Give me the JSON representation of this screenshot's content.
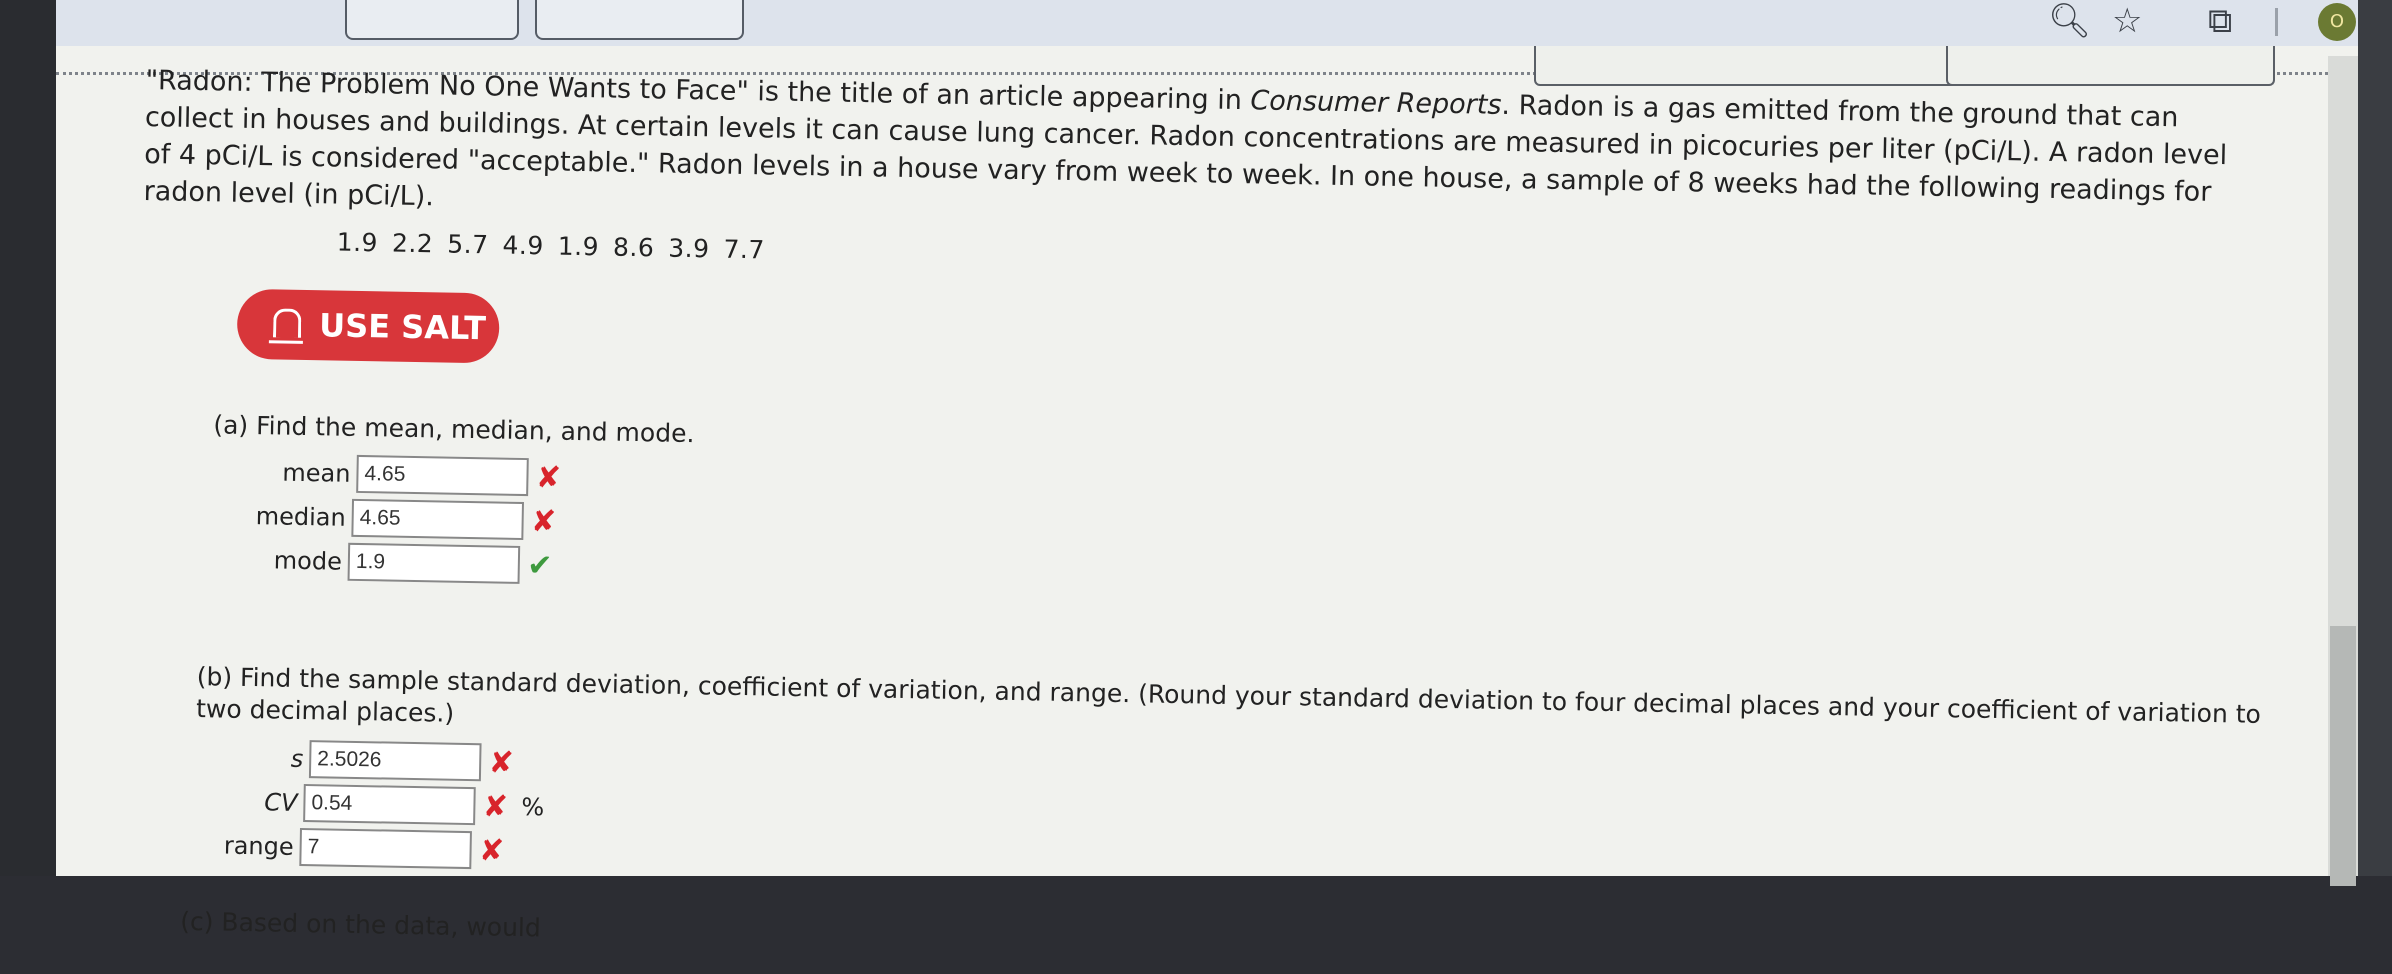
{
  "browser": {
    "icons": [
      "zoom-icon",
      "star-icon",
      "extension-icon"
    ],
    "avatar_initial": "O"
  },
  "problem": {
    "intro_before_italic": "\"Radon: The Problem No One Wants to Face\" is the title of an article appearing in ",
    "intro_italic": "Consumer Reports",
    "intro_after_italic": ". Radon is a gas emitted from the ground that can collect in houses and buildings. At certain levels it can cause lung cancer. Radon concentrations are measured in picocuries per liter (pCi/L). A radon level of 4 pCi/L is considered \"acceptable.\" Radon levels in a house vary from week to week. In one house, a sample of 8 weeks had the following readings for radon level (in pCi/L).",
    "data_values": [
      "1.9",
      "2.2",
      "5.7",
      "4.9",
      "1.9",
      "8.6",
      "3.9",
      "7.7"
    ]
  },
  "salt_button": {
    "label": "USE SALT",
    "color": "#d8363a"
  },
  "part_a": {
    "question": "(a) Find the mean, median, and mode.",
    "fields": [
      {
        "label": "mean",
        "value": "4.65",
        "status": "incorrect"
      },
      {
        "label": "median",
        "value": "4.65",
        "status": "incorrect"
      },
      {
        "label": "mode",
        "value": "1.9",
        "status": "correct"
      }
    ]
  },
  "part_b": {
    "question": "(b) Find the sample standard deviation, coefficient of variation, and range. (Round your standard deviation to four decimal places and your coefficient of variation to two decimal places.)",
    "fields": [
      {
        "label": "s",
        "value": "2.5026",
        "status": "incorrect",
        "unit": ""
      },
      {
        "label": "CV",
        "value": "0.54",
        "status": "incorrect",
        "unit": "%"
      },
      {
        "label": "range",
        "value": "7",
        "status": "incorrect",
        "unit": ""
      }
    ]
  },
  "part_c": {
    "question_fragment": "(c) Based on the data, would"
  },
  "colors": {
    "incorrect": "#d8242b",
    "correct": "#3e9a3e"
  }
}
